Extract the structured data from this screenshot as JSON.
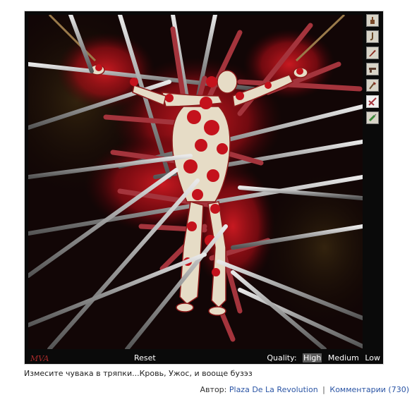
{
  "game": {
    "logo_text": "MVA",
    "reset_label": "Reset",
    "quality_label": "Quality:",
    "quality_options": [
      "High",
      "Medium",
      "Low"
    ],
    "quality_selected": "High",
    "tools": [
      {
        "name": "hand-tool-icon"
      },
      {
        "name": "hook-tool-icon"
      },
      {
        "name": "knife-tool-icon"
      },
      {
        "name": "gun-tool-icon"
      },
      {
        "name": "axe-tool-icon"
      },
      {
        "name": "spikes-tool-icon",
        "active": true
      },
      {
        "name": "syringe-tool-icon"
      }
    ]
  },
  "caption": "Измесите чувака в тряпки...Кровь, Ужос, и вооще бузэз",
  "meta": {
    "author_label": "Автор:",
    "author_name": "Plaza De La Revolution",
    "separator": "|",
    "comments_label": "Комментарии (730)"
  },
  "colors": {
    "frame_bg": "#0a0a0a",
    "blood": "#b3101a",
    "link": "#2b55a5"
  }
}
